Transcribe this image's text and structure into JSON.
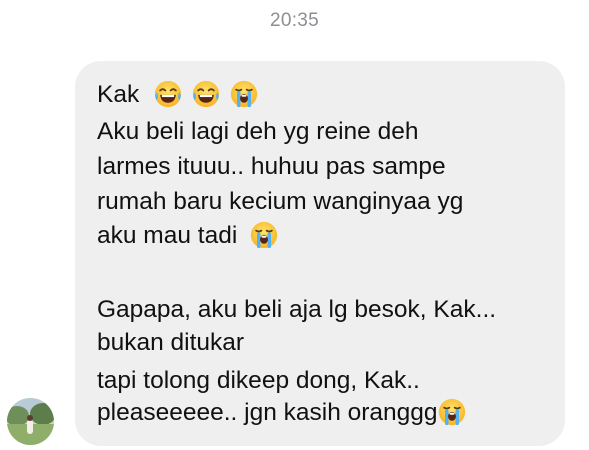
{
  "chat": {
    "timestamp": "20:35",
    "message": {
      "line1": "Kak",
      "line1_emojis": [
        "laughing-crying-emoji",
        "laughing-crying-emoji",
        "loudly-crying-emoji"
      ],
      "line2": "Aku beli lagi deh yg reine deh",
      "line3": "larmes ituuu.. huhuu pas sampe",
      "line4": "rumah baru kecium wanginyaa yg",
      "line5": "aku mau tadi",
      "line5_emoji": "loudly-crying-emoji",
      "line6": "Gapapa, aku beli aja lg besok, Kak...",
      "line7": "bukan ditukar",
      "line8": "tapi tolong dikeep dong, Kak..",
      "line9": "pleaseeeee.. jgn kasih oranggg",
      "line9_emoji": "loudly-crying-emoji"
    },
    "colors": {
      "bubble": "#efefef",
      "text": "#111111",
      "timestamp": "#8e8e93"
    }
  }
}
